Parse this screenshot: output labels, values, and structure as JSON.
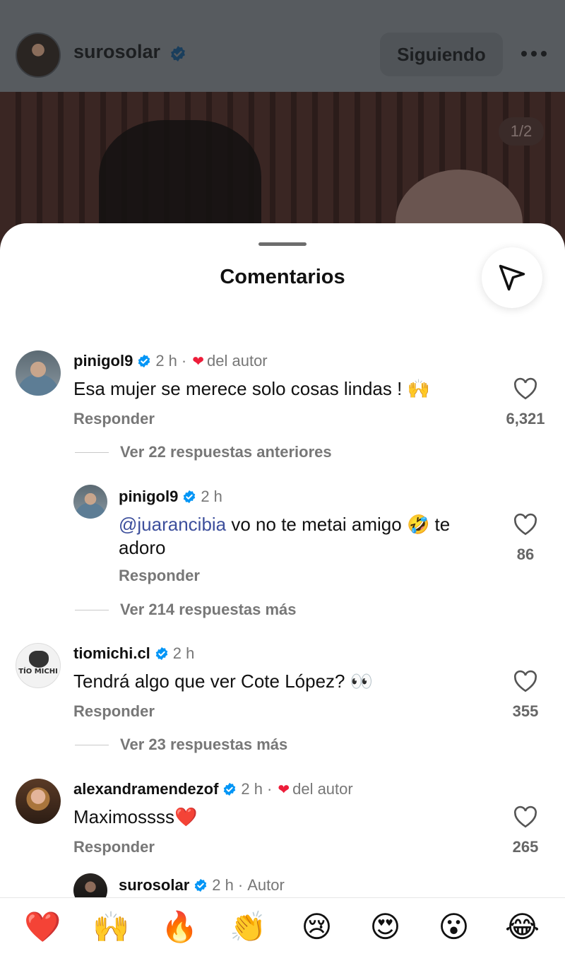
{
  "post": {
    "username": "surosolar",
    "follow_button": "Siguiendo",
    "image_counter": "1/2"
  },
  "comments_sheet": {
    "title": "Comentarios",
    "reply_label": "Responder",
    "comments": [
      {
        "username": "pinigol9",
        "time": "2 h",
        "separator": "·",
        "author_like": "del autor",
        "text": "Esa mujer se merece solo cosas lindas ! ",
        "emoji": "🙌",
        "likes": "6,321",
        "view_replies": "Ver 22 respuestas anteriores"
      },
      {
        "username": "pinigol9",
        "time": "2 h",
        "mention": "@juarancibia",
        "text": " vo no te metai amigo ",
        "emoji": "🤣",
        "text_after": " te",
        "text_line2": "adoro",
        "likes": "86",
        "view_replies": "Ver 214 respuestas más"
      },
      {
        "username": "tiomichi.cl",
        "avatar_text": "TÍO MICHI",
        "time": "2 h",
        "text": "Tendrá algo que ver Cote López? ",
        "emoji": "👀",
        "likes": "355",
        "view_replies": "Ver 23 respuestas más"
      },
      {
        "username": "alexandramendezof",
        "time": "2 h",
        "separator": "·",
        "author_like": "del autor",
        "text": "Maximossss",
        "emoji": "❤️",
        "likes": "265"
      },
      {
        "username": "surosolar",
        "time": "2 h",
        "separator": "·",
        "author_tag": "Autor"
      }
    ]
  },
  "quick_reactions": [
    "❤️",
    "🙌",
    "🔥",
    "👏",
    "😢",
    "😍",
    "😮",
    "😂"
  ],
  "colors": {
    "verified": "#0095f6",
    "heart": "#ed1d3a",
    "mention": "#3d4f9c"
  }
}
